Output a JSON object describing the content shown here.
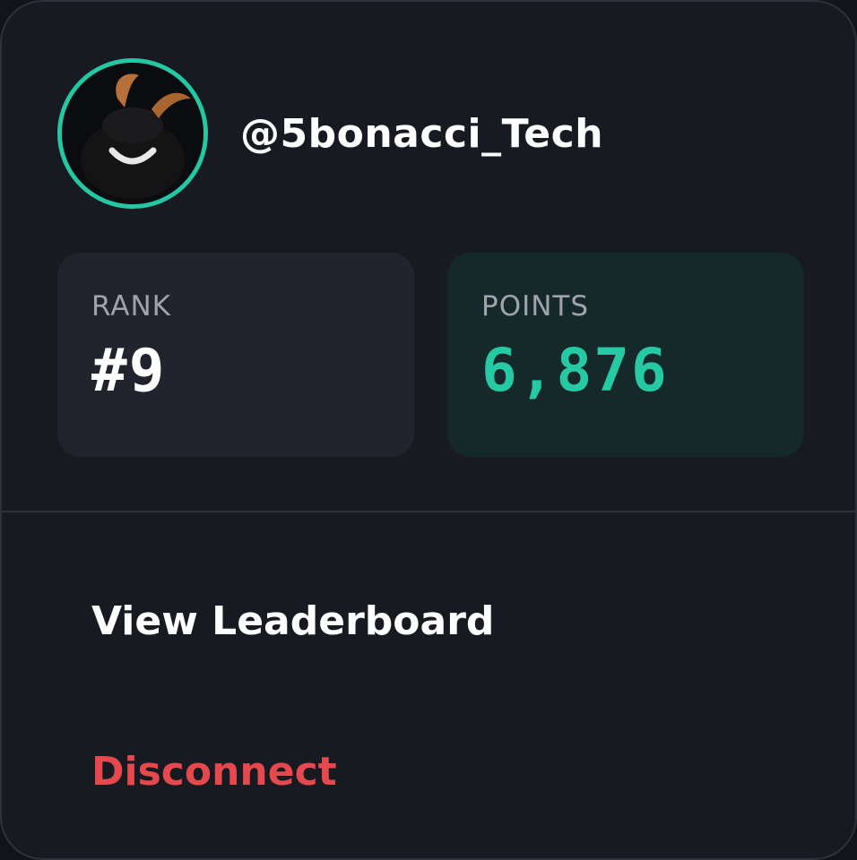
{
  "profile": {
    "username": "@5bonacci_Tech",
    "avatar_icon": "avatar-image",
    "avatar_ring_color": "#24c7a3"
  },
  "stats": {
    "rank": {
      "label": "RANK",
      "value": "#9"
    },
    "points": {
      "label": "POINTS",
      "value": "6,876",
      "color": "#25c9a4"
    }
  },
  "menu": {
    "leaderboard_label": "View Leaderboard",
    "disconnect_label": "Disconnect",
    "disconnect_color": "#e5484d"
  }
}
